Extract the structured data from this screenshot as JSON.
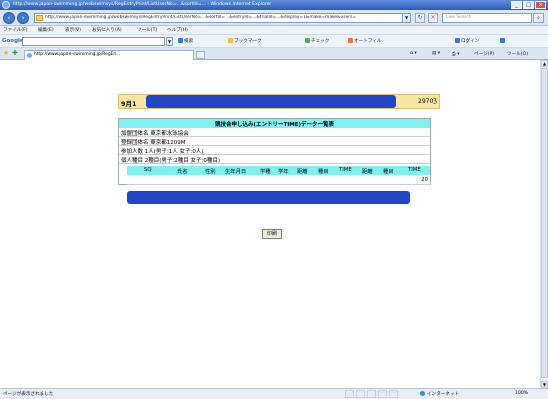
{
  "window": {
    "title": "http://www.japan-swimming.jp/webswimsys/RegEntryPrint/ListUserNo=...&sortId=... - Windows Internet Explorer",
    "controls": [
      "_",
      "□",
      "×"
    ]
  },
  "address_bar": {
    "url": "http://www.japan-swimming.jp/webswimsys/RegEntryPrint/ListUserNo=...&sortId=...&entryId=...&trialId=...&display=1&make=make&users=",
    "search_placeholder": "Live Search"
  },
  "menu": {
    "items": [
      "ファイル(F)",
      "編集(E)",
      "表示(V)",
      "お気に入り(A)",
      "ツール(T)",
      "ヘルプ(H)"
    ]
  },
  "google_toolbar": {
    "logo": "Google",
    "buttons": [
      "検索",
      "ブックマーク",
      "チェック",
      "オートフィル"
    ],
    "right": [
      "ログイン"
    ]
  },
  "tab": {
    "label": "http://www.japan-swimming.jp/RegEn...",
    "commands": [
      "ページ(P)",
      "ツール(O)"
    ]
  },
  "page": {
    "date_left": "9月1",
    "date_right": "2970ℨ",
    "table_title": "競技会申し込み(エントリーTIME)データ一覧表",
    "info_rows": [
      "加盟団体名 東京都水泳協会",
      "登録団体名 東京都1209M",
      "参加人数 1人(男子:1人 女子:0人)",
      "個人種目 2種目(男子:2種目 女子:0種目)"
    ],
    "entry_headers": [
      "SQ",
      "氏名",
      "性別",
      "生年月日",
      "学種",
      "学年",
      "距離",
      "種目",
      "TIME",
      "距離",
      "種目",
      "TIME"
    ],
    "entry_last_value": "20",
    "print_button": "印刷"
  },
  "status": {
    "text": "ページが表示されました",
    "zone": "インターネット",
    "zoom": "100%"
  }
}
